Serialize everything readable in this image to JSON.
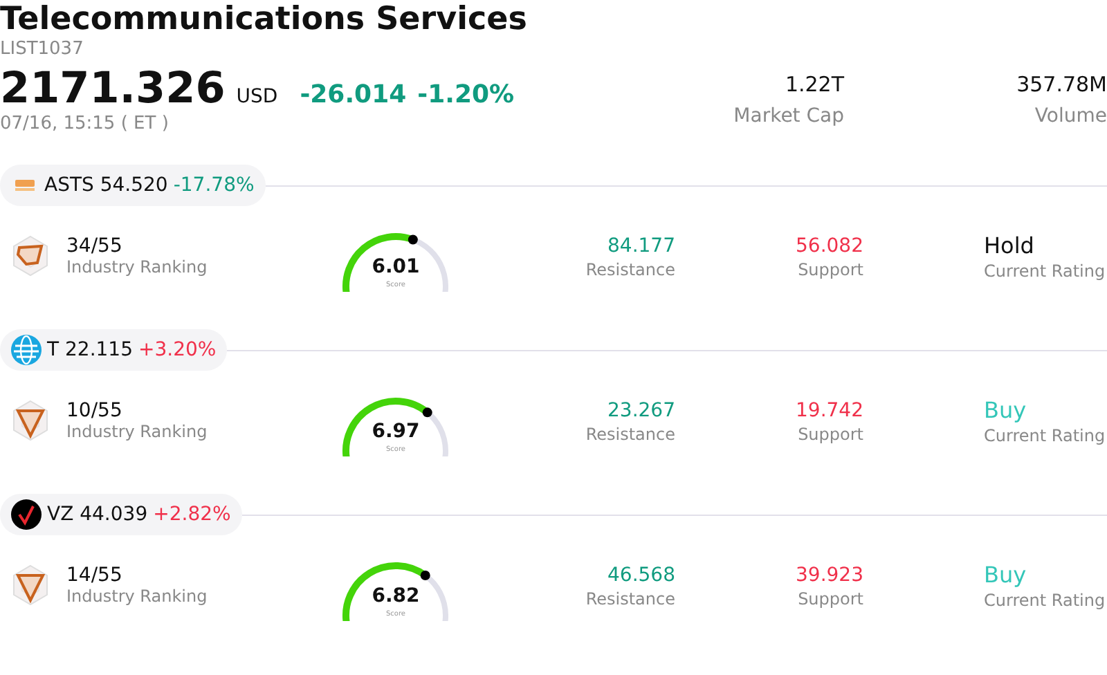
{
  "header": {
    "title": "Telecommunications Services",
    "code": "LIST1037",
    "price": "2171.326",
    "currency": "USD",
    "change": "-26.014",
    "change_pct": "-1.20%",
    "rising": false,
    "time": "07/16, 15:15  ( ET )"
  },
  "stats": [
    {
      "value": "1.22T",
      "label": "Market Cap"
    },
    {
      "value": "357.78M",
      "label": "Volume"
    }
  ],
  "stocks": [
    {
      "kind": "ast",
      "ticker": "ASTS",
      "price": "54.520",
      "change": "-17.78%",
      "rising": false,
      "ranking": "34/55",
      "ranking_label": "Industry Ranking",
      "score": "6.01",
      "score_label": "Score",
      "resistance": "84.177",
      "resistance_label": "Resistance",
      "support": "56.082",
      "support_label": "Support",
      "rating": "Hold",
      "positive": false,
      "rating_label": "Current Rating"
    },
    {
      "kind": "globe",
      "ticker": "T",
      "price": "22.115",
      "change": "+3.20%",
      "rising": true,
      "ranking": "10/55",
      "ranking_label": "Industry Ranking",
      "score": "6.97",
      "score_label": "Score",
      "resistance": "23.267",
      "resistance_label": "Resistance",
      "support": "19.742",
      "support_label": "Support",
      "rating": "Buy",
      "positive": true,
      "rating_label": "Current Rating"
    },
    {
      "kind": "check",
      "ticker": "VZ",
      "price": "44.039",
      "change": "+2.82%",
      "rising": true,
      "ranking": "14/55",
      "ranking_label": "Industry Ranking",
      "score": "6.82",
      "score_label": "Score",
      "resistance": "46.568",
      "resistance_label": "Resistance",
      "support": "39.923",
      "support_label": "Support",
      "rating": "Buy",
      "positive": true,
      "rating_label": "Current Rating"
    }
  ]
}
